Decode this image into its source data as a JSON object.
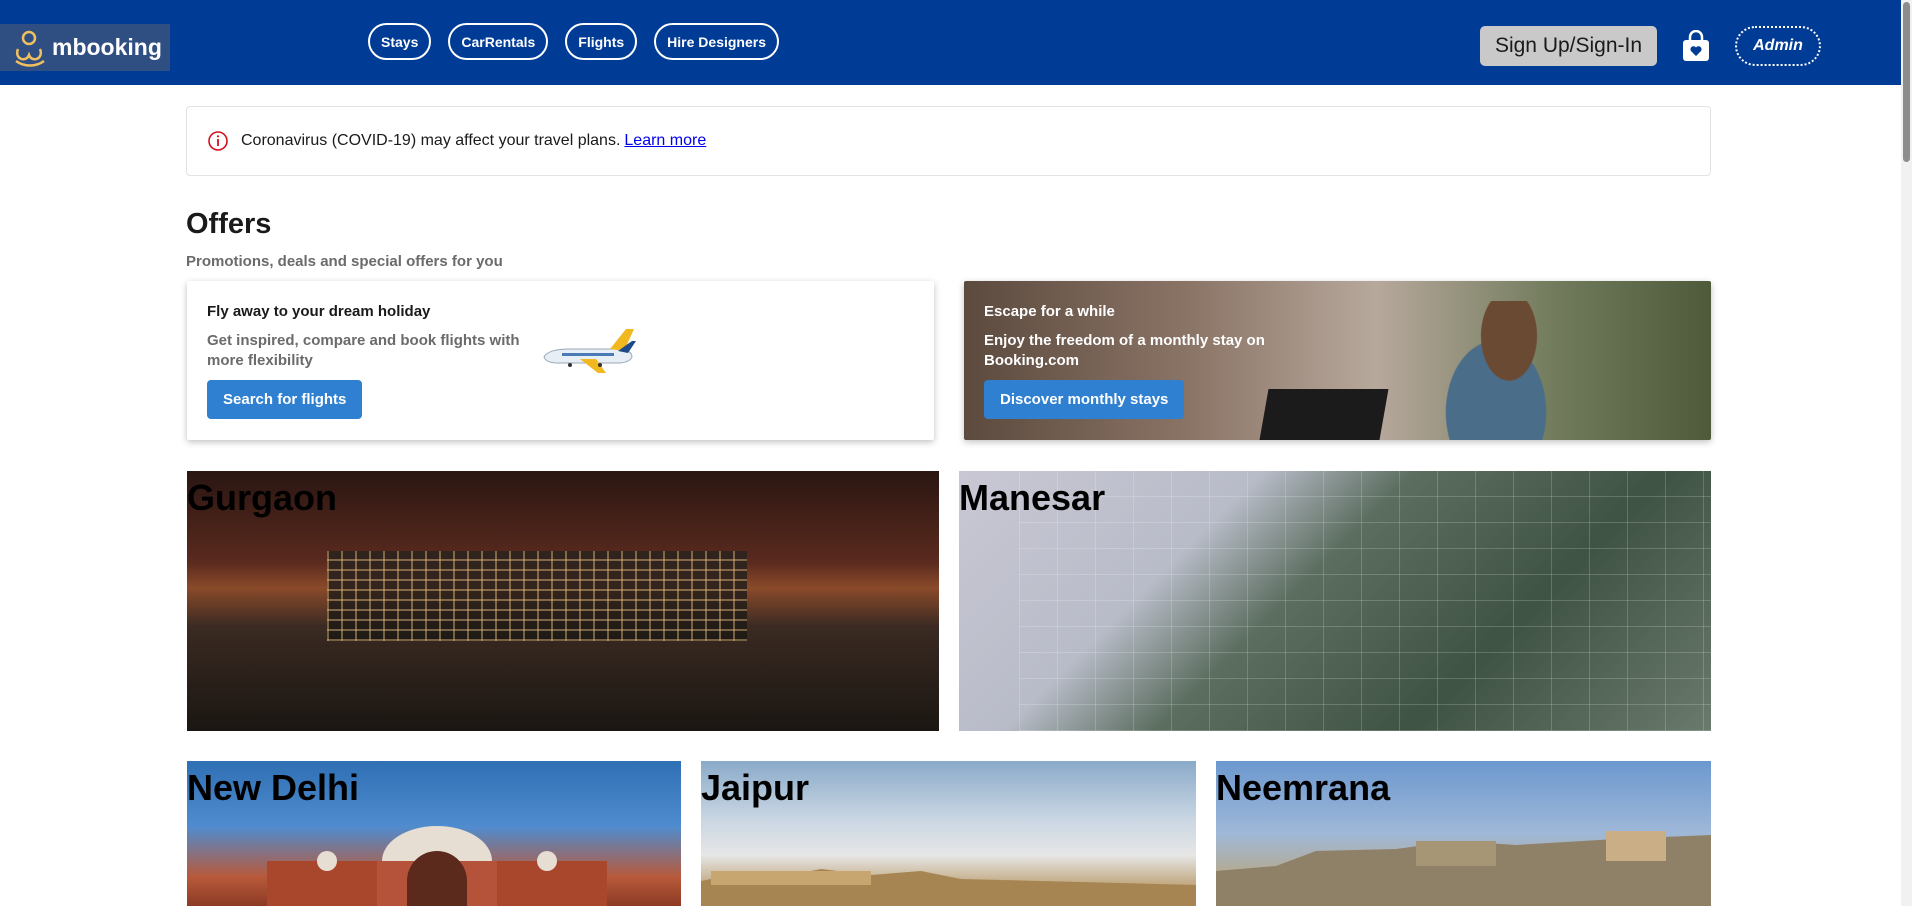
{
  "header": {
    "logo_text": "mbooking",
    "nav": [
      "Stays",
      "CarRentals",
      "Flights",
      "Hire Designers"
    ],
    "signup_label": "Sign Up/Sign-In",
    "admin_label": "Admin"
  },
  "alert": {
    "text": "Coronavirus (COVID-19) may affect your travel plans.",
    "link": "Learn more"
  },
  "offers": {
    "title": "Offers",
    "subtitle": "Promotions, deals and special offers for you",
    "cards": [
      {
        "title": "Fly away to your dream holiday",
        "description": "Get inspired, compare and book flights with more flexibility",
        "button": "Search for flights"
      },
      {
        "title": "Escape for a while",
        "description": "Enjoy the freedom of a monthly stay on Booking.com",
        "button": "Discover monthly stays"
      }
    ]
  },
  "destinations": [
    "Gurgaon",
    "Manesar",
    "New Delhi",
    "Jaipur",
    "Neemrana"
  ],
  "colors": {
    "header_bg": "#003b95",
    "button_blue": "#2f80d1",
    "alert_icon": "#d4111e"
  }
}
